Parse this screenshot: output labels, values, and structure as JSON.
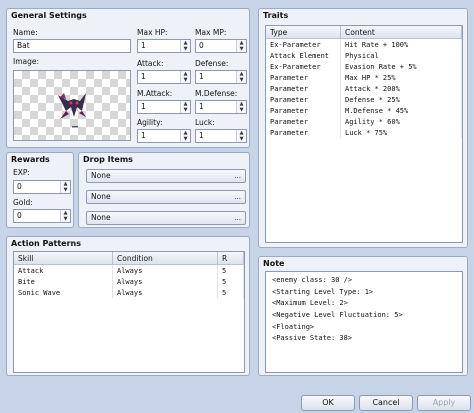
{
  "general": {
    "title": "General Settings",
    "name_label": "Name:",
    "name_value": "Bat",
    "image_label": "Image:",
    "maxhp_label": "Max HP:",
    "maxhp_value": "1",
    "maxmp_label": "Max MP:",
    "maxmp_value": "0",
    "attack_label": "Attack:",
    "attack_value": "1",
    "defense_label": "Defense:",
    "defense_value": "1",
    "mattack_label": "M.Attack:",
    "mattack_value": "1",
    "mdefense_label": "M.Defense:",
    "mdefense_value": "1",
    "agility_label": "Agility:",
    "agility_value": "1",
    "luck_label": "Luck:",
    "luck_value": "1"
  },
  "rewards": {
    "title": "Rewards",
    "exp_label": "EXP:",
    "exp_value": "0",
    "gold_label": "Gold:",
    "gold_value": "0"
  },
  "drop_items": {
    "title": "Drop Items",
    "items": [
      "None",
      "None",
      "None"
    ],
    "more_glyph": "..."
  },
  "actions": {
    "title": "Action Patterns",
    "headers": [
      "Skill",
      "Condition",
      "R"
    ],
    "rows": [
      [
        "Attack",
        "Always",
        "5"
      ],
      [
        "Bite",
        "Always",
        "5"
      ],
      [
        "Sonic Wave",
        "Always",
        "5"
      ]
    ]
  },
  "traits": {
    "title": "Traits",
    "headers": [
      "Type",
      "Content"
    ],
    "rows": [
      [
        "Ex-Parameter",
        "Hit Rate + 100%"
      ],
      [
        "Attack Element",
        "Physical"
      ],
      [
        "Ex-Parameter",
        "Evasion Rate + 5%"
      ],
      [
        "Parameter",
        "Max HP * 25%"
      ],
      [
        "Parameter",
        "Attack * 200%"
      ],
      [
        "Parameter",
        "Defense * 25%"
      ],
      [
        "Parameter",
        "M.Defense * 45%"
      ],
      [
        "Parameter",
        "Agility * 60%"
      ],
      [
        "Parameter",
        "Luck * 75%"
      ]
    ]
  },
  "note": {
    "title": "Note",
    "lines": [
      "<enemy class: 30 />",
      "<Starting Level Type: 1>",
      "<Maximum Level: 2>",
      "<Negative Level Fluctuation: 5>",
      "<Floating>",
      "<Passive State: 38>"
    ]
  },
  "footer": {
    "ok": "OK",
    "cancel": "Cancel",
    "apply": "Apply"
  },
  "icons": {
    "spin_up": "▲",
    "spin_down": "▼"
  }
}
